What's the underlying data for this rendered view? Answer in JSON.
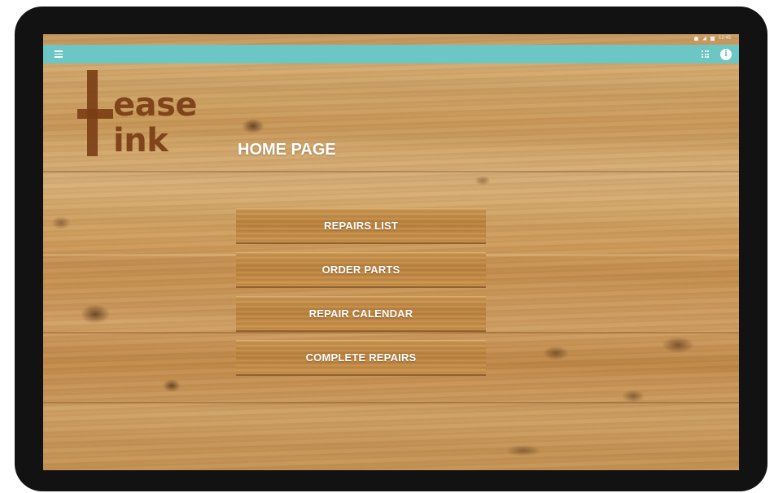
{
  "logo": {
    "line1": "ease",
    "line2": "ink",
    "initial": "L"
  },
  "page": {
    "title": "HOME PAGE"
  },
  "menu": {
    "items": [
      {
        "label": "REPAIRS LIST"
      },
      {
        "label": "ORDER PARTS"
      },
      {
        "label": "REPAIR CALENDAR"
      },
      {
        "label": "COMPLETE REPAIRS"
      }
    ]
  },
  "app_bar": {
    "accent_color": "#6cc6c4",
    "left_icon": "menu-icon",
    "right_icons": [
      "apps-grid-icon",
      "info-icon"
    ],
    "info_glyph": "i"
  },
  "status_bar": {
    "icons": [
      "wifi-icon",
      "signal-icon",
      "battery-icon"
    ],
    "time": "12:45"
  }
}
